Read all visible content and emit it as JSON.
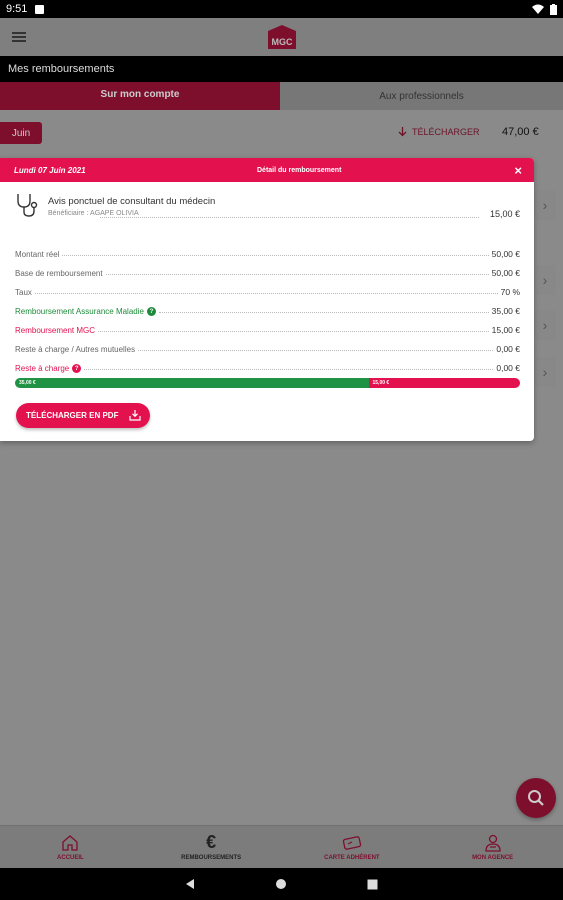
{
  "status_bar": {
    "time": "9:51"
  },
  "app_bar": {
    "logo_text": "MGC"
  },
  "section": {
    "title": "Mes remboursements"
  },
  "tabs": [
    {
      "label": "Sur mon compte",
      "active": true
    },
    {
      "label": "Aux professionnels",
      "active": false
    }
  ],
  "background": {
    "month": "Juin",
    "download_label": "TÉLÉCHARGER",
    "total": "47,00 €"
  },
  "modal": {
    "date": "Lundi 07 Juin 2021",
    "title": "Détail du remboursement",
    "close": "×",
    "act_title": "Avis ponctuel de consultant du médecin",
    "beneficiary": "Bénéficiaire : AGAPE OLIVIA",
    "act_amount": "15,00 €",
    "rows": [
      {
        "label": "Montant réel",
        "value": "50,00 €",
        "style": "grey"
      },
      {
        "label": "Base de remboursement",
        "value": "50,00 €",
        "style": "grey"
      },
      {
        "label": "Taux",
        "value": "70 %",
        "style": "grey"
      },
      {
        "label": "Remboursement Assurance Maladie",
        "value": "35,00 €",
        "style": "green",
        "badge": "?"
      },
      {
        "label": "Remboursement MGC",
        "value": "15,00 €",
        "style": "red"
      },
      {
        "label": "Reste à charge / Autres mutuelles",
        "value": "0,00 €",
        "style": "grey"
      },
      {
        "label": "Reste à charge",
        "value": "0,00 €",
        "style": "red",
        "badge": "?"
      }
    ],
    "bar": {
      "green_label": "35,00 €",
      "red_label": "15,00 €",
      "green_fraction": 0.7
    },
    "pdf_button": "TÉLÉCHARGER EN PDF"
  },
  "bottom_nav": [
    {
      "label": "ACCUEIL",
      "icon": "home-icon",
      "active": false
    },
    {
      "label": "REMBOURSEMENTS",
      "icon": "euro-icon",
      "active": true
    },
    {
      "label": "CARTE ADHÉRENT",
      "icon": "card-icon",
      "active": false
    },
    {
      "label": "MON AGENCE",
      "icon": "agency-icon",
      "active": false
    }
  ],
  "colors": {
    "accent": "#e4114f",
    "dark_accent": "#7d0f2d",
    "green": "#209244"
  }
}
